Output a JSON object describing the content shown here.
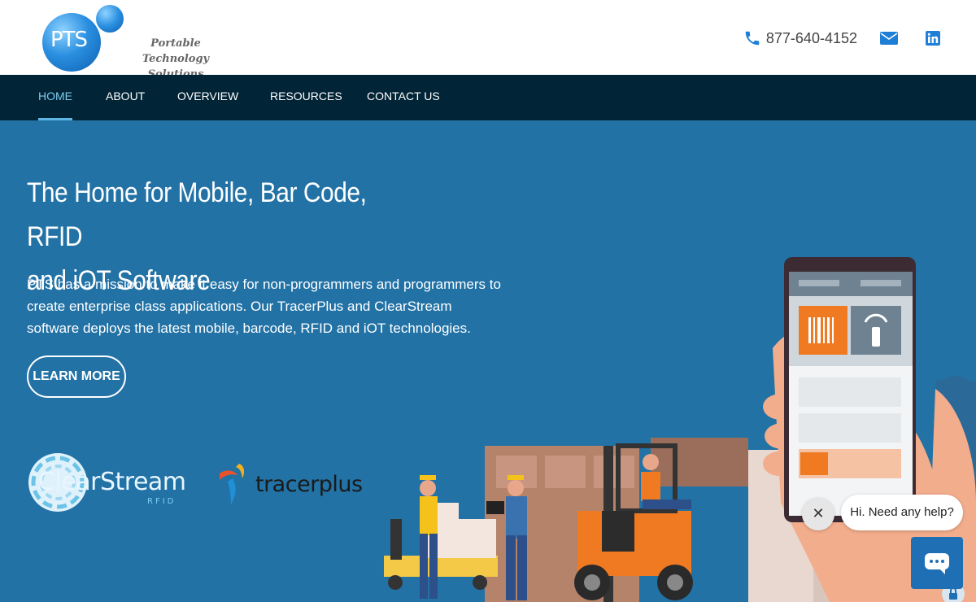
{
  "header": {
    "logo_mark": "PTS",
    "logo_tagline_line1": "Portable Technology",
    "logo_tagline_line2": "Solutions",
    "phone": "877-640-4152"
  },
  "nav": {
    "items": [
      {
        "label": "HOME",
        "active": true
      },
      {
        "label": "ABOUT",
        "active": false
      },
      {
        "label": "OVERVIEW",
        "active": false
      },
      {
        "label": "RESOURCES",
        "active": false
      },
      {
        "label": "CONTACT US",
        "active": false
      }
    ]
  },
  "hero": {
    "title_line1": "The Home for Mobile, Bar Code, RFID",
    "title_line2": "and iOT Software",
    "description": "PTS has a mission to make it easy for non-programmers and programmers to create enterprise class applications. Our TracerPlus and ClearStream software deploys the latest mobile, barcode, RFID and iOT technologies.",
    "button_label": "LEARN MORE"
  },
  "partners": {
    "clearstream_name": "ClearStream",
    "clearstream_sub": "RFID",
    "tracerplus_name": "tracerplus"
  },
  "chat": {
    "greeting": "Hi. Need any help?"
  },
  "colors": {
    "nav_bg": "#012436",
    "hero_bg": "#2272a6",
    "accent": "#1f7fd6",
    "orange": "#e8792b"
  }
}
